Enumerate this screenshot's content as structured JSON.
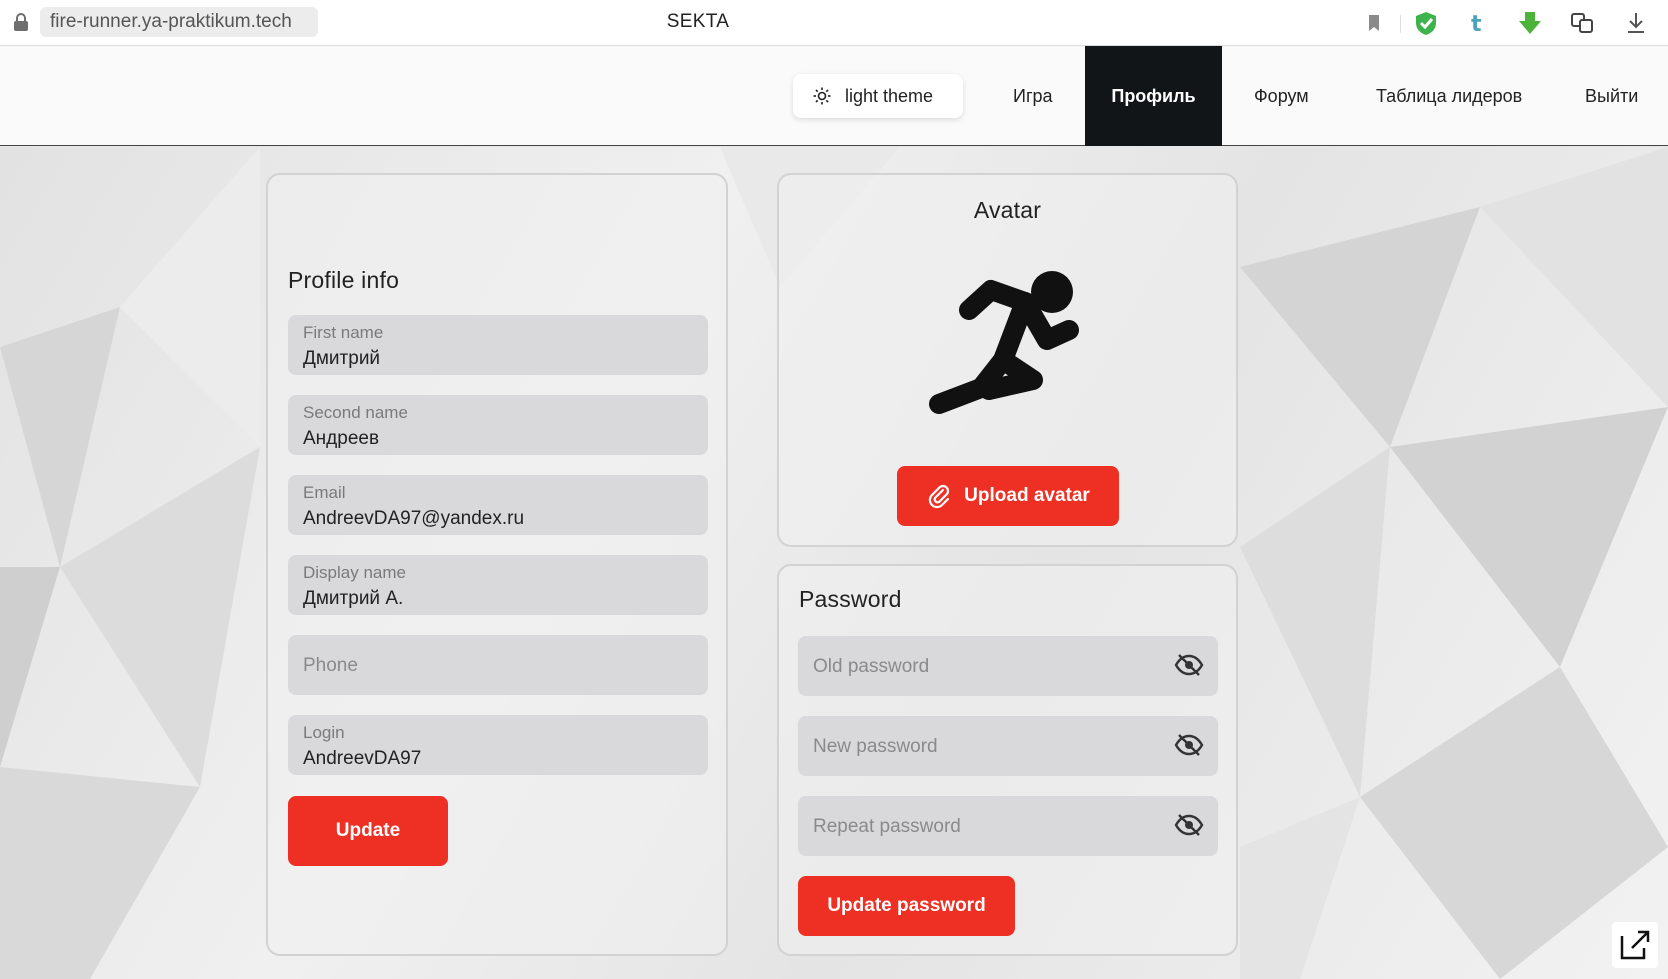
{
  "browser": {
    "url": "fire-runner.ya-praktikum.tech",
    "title": "SEKTA",
    "toolbar_icons": [
      "bookmark-icon",
      "shield-check-icon",
      "tumblr-icon",
      "download-arrow-icon",
      "translate-icon",
      "downloads-icon"
    ]
  },
  "header": {
    "theme_button": {
      "label": "light theme",
      "icon": "sun-icon"
    },
    "nav": [
      {
        "label": "Игра",
        "active": false
      },
      {
        "label": "Профиль",
        "active": true
      },
      {
        "label": "Форум",
        "active": false
      },
      {
        "label": "Таблица лидеров",
        "active": false
      },
      {
        "label": "Выйти",
        "active": false
      }
    ]
  },
  "profile": {
    "title": "Profile info",
    "fields": [
      {
        "label": "First name",
        "value": "Дмитрий"
      },
      {
        "label": "Second name",
        "value": "Андреев"
      },
      {
        "label": "Email",
        "value": "AndreevDA97@yandex.ru"
      },
      {
        "label": "Display name",
        "value": "Дмитрий А."
      },
      {
        "label": "Phone",
        "value": ""
      },
      {
        "label": "Login",
        "value": "AndreevDA97"
      }
    ],
    "submit_label": "Update"
  },
  "avatar": {
    "title": "Avatar",
    "image_icon": "runner-icon",
    "upload_label": "Upload avatar",
    "upload_icon": "paperclip-icon"
  },
  "password": {
    "title": "Password",
    "fields": [
      {
        "placeholder": "Old password",
        "icon": "eye-off-icon"
      },
      {
        "placeholder": "New password",
        "icon": "eye-off-icon"
      },
      {
        "placeholder": "Repeat password",
        "icon": "eye-off-icon"
      }
    ],
    "submit_label": "Update password"
  },
  "colors": {
    "accent": "#ee3024",
    "nav_active_bg": "#121517",
    "field_bg": "#d9d9db"
  }
}
